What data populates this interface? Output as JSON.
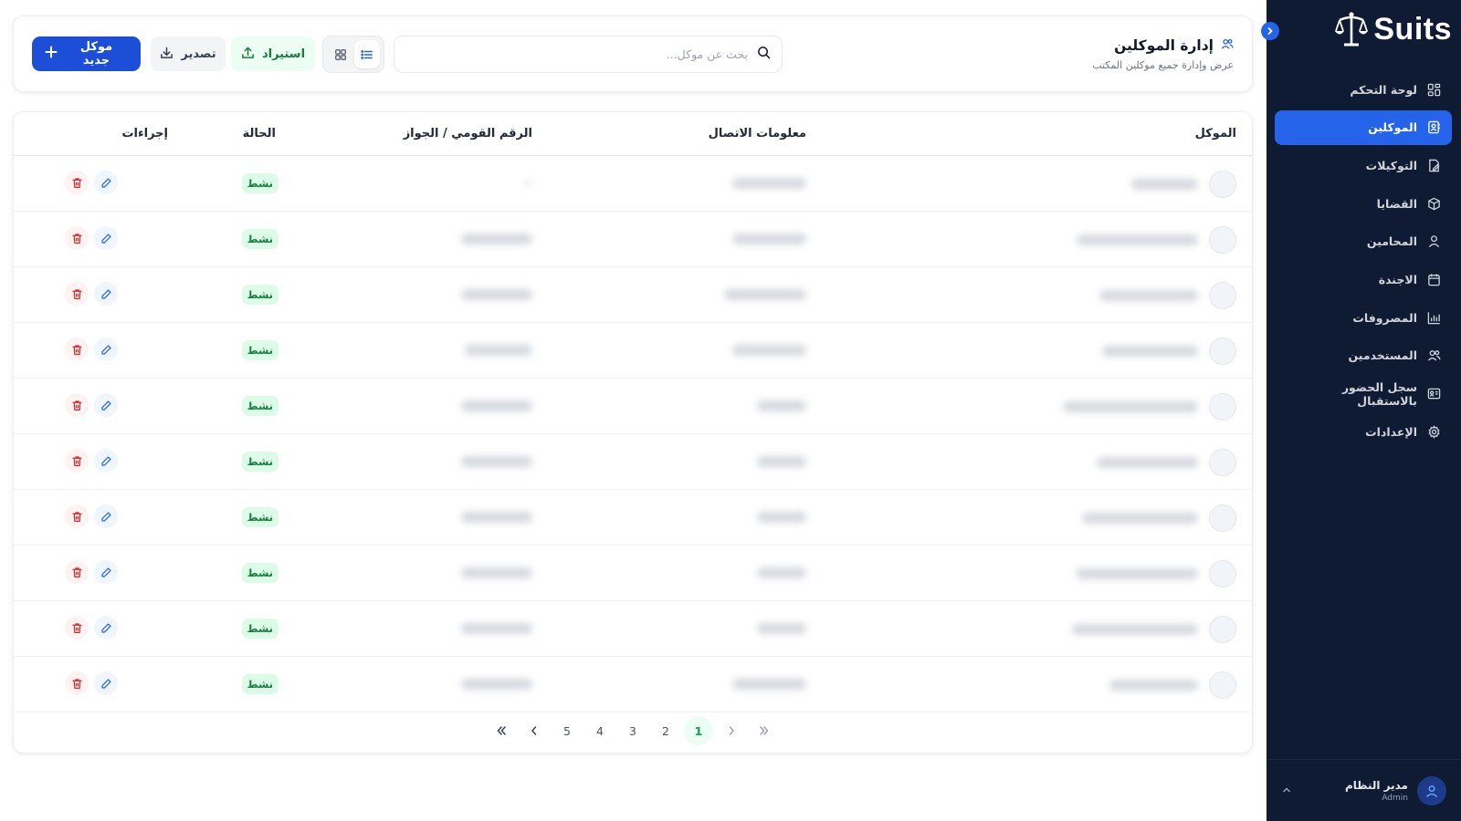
{
  "app": {
    "brand": "Suits"
  },
  "sidebar": {
    "items": [
      {
        "label": "لوحة التحكم",
        "icon": "dashboard-icon",
        "active": false
      },
      {
        "label": "الموكلين",
        "icon": "clients-icon",
        "active": true
      },
      {
        "label": "التوكيلات",
        "icon": "power-of-attorney-icon",
        "active": false
      },
      {
        "label": "القضايا",
        "icon": "cases-icon",
        "active": false
      },
      {
        "label": "المحامين",
        "icon": "lawyer-icon",
        "active": false
      },
      {
        "label": "الاجندة",
        "icon": "calendar-icon",
        "active": false
      },
      {
        "label": "المصروفات",
        "icon": "expenses-chart-icon",
        "active": false
      },
      {
        "label": "المستخدمين",
        "icon": "users-icon",
        "active": false
      },
      {
        "label": "سجل الحضور بالاستقبال",
        "icon": "attendance-icon",
        "active": false
      },
      {
        "label": "الإعدادات",
        "icon": "settings-icon",
        "active": false
      }
    ],
    "user": {
      "name": "مدير النظام",
      "role": "Admin"
    }
  },
  "header": {
    "title": "إدارة الموكلين",
    "subtitle": "عرض وإدارة جميع موكلين المكتب",
    "search_placeholder": "بحث عن موكل...",
    "search_value": "",
    "view_mode": "list",
    "import_label": "استيراد",
    "export_label": "تصدير",
    "new_label": "موكل جديد"
  },
  "table": {
    "columns": {
      "client": "الموكل",
      "contact": "معلومات الاتصال",
      "id": "الرقم القومي / الجواز",
      "status": "الحالة",
      "actions": "إجراءات"
    },
    "rows": [
      {
        "status": "نشط",
        "name_blur": 0.22,
        "contact_blur": 0.85,
        "id_blur": 0.0
      },
      {
        "status": "نشط",
        "name_blur": 0.62,
        "contact_blur": 0.85,
        "id_blur": 0.85
      },
      {
        "status": "نشط",
        "name_blur": 0.45,
        "contact_blur": 1.0,
        "id_blur": 0.85
      },
      {
        "status": "نشط",
        "name_blur": 0.43,
        "contact_blur": 0.85,
        "id_blur": 0.8
      },
      {
        "status": "نشط",
        "name_blur": 0.72,
        "contact_blur": 0.4,
        "id_blur": 0.85
      },
      {
        "status": "نشط",
        "name_blur": 0.47,
        "contact_blur": 0.4,
        "id_blur": 0.85
      },
      {
        "status": "نشط",
        "name_blur": 0.58,
        "contact_blur": 0.4,
        "id_blur": 0.85
      },
      {
        "status": "نشط",
        "name_blur": 0.62,
        "contact_blur": 0.4,
        "id_blur": 0.85
      },
      {
        "status": "نشط",
        "name_blur": 0.65,
        "contact_blur": 0.4,
        "id_blur": 0.85
      },
      {
        "status": "نشط",
        "name_blur": 0.38,
        "contact_blur": 0.85,
        "id_blur": 0.85
      }
    ]
  },
  "pagination": {
    "pages": [
      "1",
      "2",
      "3",
      "4",
      "5"
    ],
    "current": "1"
  },
  "colors": {
    "sidebar_bg": "#0f1a33",
    "accent": "#2563eb",
    "success": "#15803d",
    "danger": "#dc2626"
  }
}
